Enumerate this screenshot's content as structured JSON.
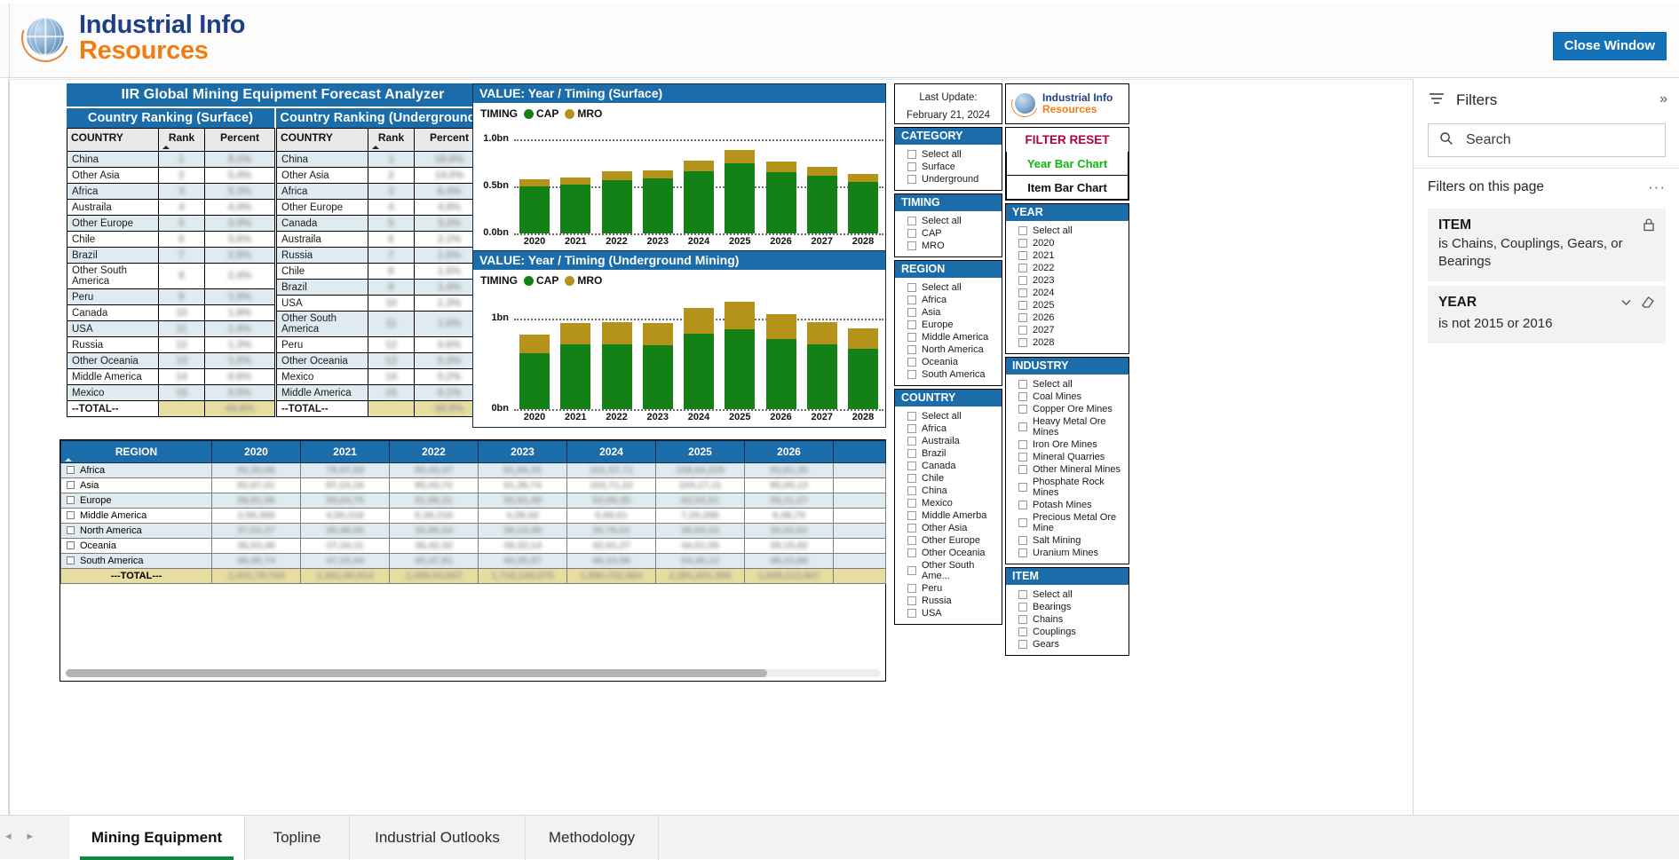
{
  "app": {
    "brand_line1": "Industrial Info",
    "brand_line2": "Resources",
    "close_window": "Close Window"
  },
  "report": {
    "title": "IIR Global Mining Equipment Forecast Analyzer"
  },
  "ranking_surface": {
    "title": "Country Ranking (Surface)",
    "columns": [
      "COUNTRY",
      "Rank",
      "Percent"
    ],
    "rows": [
      {
        "country": "China",
        "rank": "1",
        "percent": "8.2%"
      },
      {
        "country": "Other Asia",
        "rank": "2",
        "percent": "5.4%"
      },
      {
        "country": "Africa",
        "rank": "3",
        "percent": "5.3%"
      },
      {
        "country": "Austraila",
        "rank": "4",
        "percent": "4.4%"
      },
      {
        "country": "Other Europe",
        "rank": "5",
        "percent": "3.9%"
      },
      {
        "country": "Chile",
        "rank": "6",
        "percent": "3.6%"
      },
      {
        "country": "Brazil",
        "rank": "7",
        "percent": "2.8%"
      },
      {
        "country": "Other South America",
        "rank": "8",
        "percent": "2.4%"
      },
      {
        "country": "Peru",
        "rank": "9",
        "percent": "1.9%"
      },
      {
        "country": "Canada",
        "rank": "10",
        "percent": "1.8%"
      },
      {
        "country": "USA",
        "rank": "11",
        "percent": "1.4%"
      },
      {
        "country": "Russia",
        "rank": "12",
        "percent": "1.3%"
      },
      {
        "country": "Other Oceania",
        "rank": "13",
        "percent": "1.0%"
      },
      {
        "country": "Middle America",
        "rank": "14",
        "percent": "0.6%"
      },
      {
        "country": "Mexico",
        "rank": "15",
        "percent": "0.5%"
      }
    ],
    "total_label": "--TOTAL--",
    "total_rank": "",
    "total_percent": "44.6%"
  },
  "ranking_underground": {
    "title": "Country Ranking (Underground)",
    "columns": [
      "COUNTRY",
      "Rank",
      "Percent"
    ],
    "rows": [
      {
        "country": "China",
        "rank": "1",
        "percent": "18.6%"
      },
      {
        "country": "Other Asia",
        "rank": "2",
        "percent": "14.0%"
      },
      {
        "country": "Africa",
        "rank": "3",
        "percent": "6.4%"
      },
      {
        "country": "Other Europe",
        "rank": "4",
        "percent": "4.8%"
      },
      {
        "country": "Canada",
        "rank": "5",
        "percent": "3.2%"
      },
      {
        "country": "Austraila",
        "rank": "6",
        "percent": "2.1%"
      },
      {
        "country": "Russia",
        "rank": "7",
        "percent": "1.6%"
      },
      {
        "country": "Chile",
        "rank": "8",
        "percent": "1.5%"
      },
      {
        "country": "Brazil",
        "rank": "9",
        "percent": "1.4%"
      },
      {
        "country": "USA",
        "rank": "10",
        "percent": "1.3%"
      },
      {
        "country": "Other South America",
        "rank": "11",
        "percent": "1.0%"
      },
      {
        "country": "Peru",
        "rank": "12",
        "percent": "0.6%"
      },
      {
        "country": "Other Oceania",
        "rank": "13",
        "percent": "0.3%"
      },
      {
        "country": "Mexico",
        "rank": "14",
        "percent": "0.2%"
      },
      {
        "country": "Middle America",
        "rank": "15",
        "percent": "0.1%"
      }
    ],
    "total_label": "--TOTAL--",
    "total_rank": "",
    "total_percent": "56.9%"
  },
  "chart_data": [
    {
      "type": "bar",
      "stacked": true,
      "title": "VALUE: Year / Timing (Surface)",
      "legend_title": "TIMING",
      "legend_position": "top-left",
      "series": [
        {
          "name": "CAP",
          "color": "#148117",
          "values": [
            0.5,
            0.515,
            0.565,
            0.585,
            0.66,
            0.745,
            0.655,
            0.615,
            0.545
          ]
        },
        {
          "name": "MRO",
          "color": "#b5921a",
          "values": [
            0.075,
            0.075,
            0.095,
            0.085,
            0.115,
            0.14,
            0.11,
            0.095,
            0.085
          ]
        }
      ],
      "categories": [
        "2020",
        "2021",
        "2022",
        "2023",
        "2024",
        "2025",
        "2026",
        "2027",
        "2028"
      ],
      "x": [
        "2020",
        "2021",
        "2022",
        "2023",
        "2024",
        "2025",
        "2026",
        "2027",
        "2028"
      ],
      "xlabel": "",
      "ylabel": "",
      "ylim": [
        0,
        1.15
      ],
      "ytick_labels": [
        "0.0bn",
        "0.5bn",
        "1.0bn"
      ],
      "ytick_values": [
        0,
        0.5,
        1.0
      ],
      "grid": true
    },
    {
      "type": "bar",
      "stacked": true,
      "title": "VALUE: Year / Timing (Underground Mining)",
      "legend_title": "TIMING",
      "legend_position": "top-left",
      "series": [
        {
          "name": "CAP",
          "color": "#148117",
          "values": [
            0.62,
            0.72,
            0.72,
            0.71,
            0.84,
            0.89,
            0.78,
            0.72,
            0.67
          ]
        },
        {
          "name": "MRO",
          "color": "#b5921a",
          "values": [
            0.21,
            0.24,
            0.25,
            0.25,
            0.28,
            0.3,
            0.27,
            0.25,
            0.23
          ]
        }
      ],
      "categories": [
        "2020",
        "2021",
        "2022",
        "2023",
        "2024",
        "2025",
        "2026",
        "2027",
        "2028"
      ],
      "x": [
        "2020",
        "2021",
        "2022",
        "2023",
        "2024",
        "2025",
        "2026",
        "2027",
        "2028"
      ],
      "xlabel": "",
      "ylabel": "",
      "ylim": [
        0,
        1.3
      ],
      "ytick_labels": [
        "0bn",
        "1bn"
      ],
      "ytick_values": [
        0,
        1.0
      ],
      "grid": true
    }
  ],
  "region_matrix": {
    "columns": [
      "REGION",
      "2020",
      "2021",
      "2022",
      "2023",
      "2024",
      "2025",
      "2026"
    ],
    "rows": [
      {
        "region": "Africa",
        "values": [
          "92,30,66",
          "78,97,59",
          "85,43,47",
          "81,96,35",
          "101,07,71",
          "108,64,225",
          "93,81,30"
        ]
      },
      {
        "region": "Asia",
        "values": [
          "82,67,01",
          "87,23,16",
          "85,43,72",
          "91,36,74",
          "102,71,22",
          "104,17,11",
          "95,00,13"
        ]
      },
      {
        "region": "Europe",
        "values": [
          "58,81,56",
          "59,04,75",
          "51,86,31",
          "55,91,49",
          "52,09,35",
          "62,53,91",
          "55,11,27"
        ]
      },
      {
        "region": "Middle America",
        "values": [
          "3,56,365",
          "4,50,316",
          "5,36,218",
          "4,28,92",
          "5,69,61",
          "7,20,286",
          "6,48,79"
        ]
      },
      {
        "region": "North America",
        "values": [
          "37,03,27",
          "39,48,06",
          "32,86,54",
          "36,13,48",
          "35,76,01",
          "39,60,33",
          "35,02,61"
        ]
      },
      {
        "region": "Oceania",
        "values": [
          "36,53,46",
          "37,34,11",
          "36,42,32",
          "36,32,14",
          "42,61,27",
          "44,01,55",
          "39,15,82"
        ]
      },
      {
        "region": "South America",
        "values": [
          "46,96,74",
          "47,15,34",
          "45,47,81",
          "44,30,57",
          "49,15,98",
          "54,40,12",
          "48,23,66"
        ]
      }
    ],
    "total_label": "---TOTAL---",
    "total_values": [
      "1,431,78,744",
      "1,461,90,814",
      "1,408,04,607",
      "1,716,148,675",
      "1,980,752,664",
      "2,381,601,586",
      "1,698,213,607"
    ]
  },
  "slicers": {
    "last_update": {
      "label": "Last Update:",
      "value": "February 21, 2024"
    },
    "category": {
      "title": "CATEGORY",
      "items": [
        "Select all",
        "Surface",
        "Underground"
      ]
    },
    "timing": {
      "title": "TIMING",
      "items": [
        "Select all",
        "CAP",
        "MRO"
      ]
    },
    "region": {
      "title": "REGION",
      "items": [
        "Select all",
        "Africa",
        "Asia",
        "Europe",
        "Middle America",
        "North America",
        "Oceania",
        "South America"
      ]
    },
    "country": {
      "title": "COUNTRY",
      "items": [
        "Select all",
        "Africa",
        "Austraila",
        "Brazil",
        "Canada",
        "Chile",
        "China",
        "Mexico",
        "Middle Amerba",
        "Other Asia",
        "Other Europe",
        "Other Oceania",
        "Other South Ame...",
        "Peru",
        "Russia",
        "USA"
      ]
    },
    "year": {
      "title": "YEAR",
      "items": [
        "Select all",
        "2020",
        "2021",
        "2022",
        "2023",
        "2024",
        "2025",
        "2026",
        "2027",
        "2028"
      ]
    },
    "industry": {
      "title": "INDUSTRY",
      "items": [
        "Select all",
        "Coal Mines",
        "Copper Ore Mines",
        "Heavy Metal Ore Mines",
        "Iron Ore Mines",
        "Mineral Quarries",
        "Other Mineral Mines",
        "Phosphate Rock Mines",
        "Potash Mines",
        "Precious Metal Ore Mine",
        "Salt Mining",
        "Uranium Mines"
      ]
    },
    "item": {
      "title": "ITEM",
      "items": [
        "Select all",
        "Bearings",
        "Chains",
        "Couplings",
        "Gears"
      ]
    }
  },
  "buttons": {
    "filter_reset": "FILTER RESET",
    "year_bar_chart": "Year Bar Chart",
    "item_bar_chart": "Item Bar Chart"
  },
  "filter_pane": {
    "title": "Filters",
    "search_placeholder": "Search",
    "section_label": "Filters on this page",
    "filters": [
      {
        "name": "ITEM",
        "description": "is Chains, Couplings, Gears, or Bearings",
        "locked": true
      },
      {
        "name": "YEAR",
        "description": "is not 2015 or 2016",
        "locked": false
      }
    ]
  },
  "tabs": [
    {
      "label": "Mining Equipment",
      "active": true
    },
    {
      "label": "Topline",
      "active": false
    },
    {
      "label": "Industrial Outlooks",
      "active": false
    },
    {
      "label": "Methodology",
      "active": false
    }
  ]
}
